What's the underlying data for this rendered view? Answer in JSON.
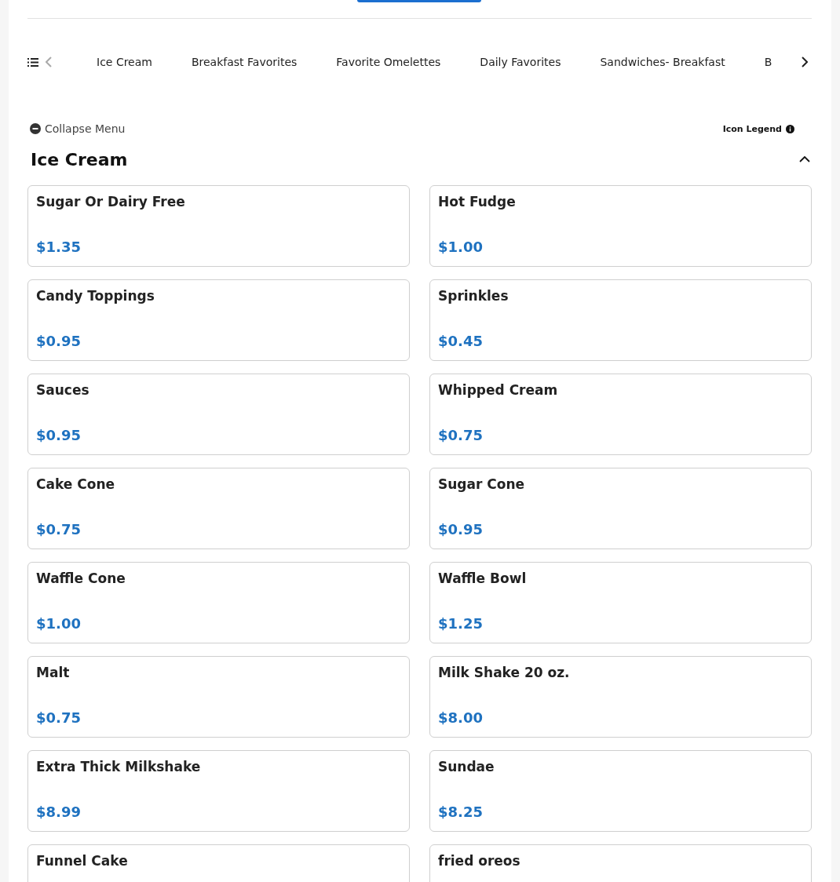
{
  "categories": [
    {
      "label": "Ice Cream"
    },
    {
      "label": "Breakfast Favorites"
    },
    {
      "label": "Favorite Omelettes"
    },
    {
      "label": "Daily Favorites"
    },
    {
      "label": "Sandwiches- Breakfast"
    },
    {
      "label": "B"
    }
  ],
  "collapse_menu": {
    "label": "Collapse Menu"
  },
  "icon_legend": {
    "label": "Icon Legend"
  },
  "section": {
    "title": "Ice Cream",
    "expanded": true
  },
  "items": [
    {
      "name": "Sugar Or Dairy Free",
      "price": "$1.35"
    },
    {
      "name": "Hot Fudge",
      "price": "$1.00"
    },
    {
      "name": "Candy Toppings",
      "price": "$0.95"
    },
    {
      "name": "Sprinkles",
      "price": "$0.45"
    },
    {
      "name": "Sauces",
      "price": "$0.95"
    },
    {
      "name": "Whipped Cream",
      "price": "$0.75"
    },
    {
      "name": "Cake Cone",
      "price": "$0.75"
    },
    {
      "name": "Sugar Cone",
      "price": "$0.95"
    },
    {
      "name": "Waffle Cone",
      "price": "$1.00"
    },
    {
      "name": "Waffle Bowl",
      "price": "$1.25"
    },
    {
      "name": "Malt",
      "price": "$0.75"
    },
    {
      "name": "Milk Shake 20 oz.",
      "price": "$8.00"
    },
    {
      "name": "Extra Thick Milkshake",
      "price": "$8.99"
    },
    {
      "name": "Sundae",
      "price": "$8.25"
    },
    {
      "name": "Funnel Cake"
    },
    {
      "name": "fried oreos"
    }
  ]
}
